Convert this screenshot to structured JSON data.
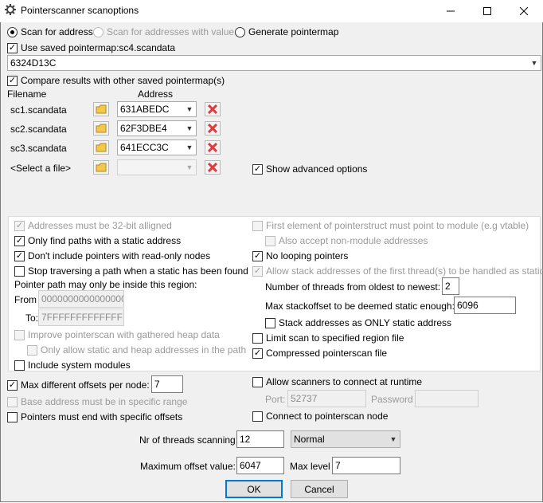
{
  "window": {
    "title": "Pointerscanner scanoptions",
    "minimize_icon": "minimize-icon",
    "maximize_icon": "maximize-icon",
    "close_icon": "close-icon"
  },
  "scan_mode": {
    "scan_for_address": "Scan for address",
    "scan_for_value": "Scan for addresses with value",
    "generate_pointermap": "Generate pointermap",
    "selected": "scan_for_address"
  },
  "saved_pointermap": {
    "label": "Use saved pointermap:sc4.scandata",
    "checked": true,
    "address_value": "6324D13C"
  },
  "compare": {
    "label": "Compare results with other saved pointermap(s)",
    "checked": true,
    "header_filename": "Filename",
    "header_address": "Address",
    "rows": [
      {
        "filename": "sc1.scandata",
        "address": "631ABEDC"
      },
      {
        "filename": "sc2.scandata",
        "address": "62F3DBE4"
      },
      {
        "filename": "sc3.scandata",
        "address": "641ECC3C"
      },
      {
        "filename": "<Select a file>",
        "address": ""
      }
    ]
  },
  "show_advanced": {
    "label": "Show advanced options",
    "checked": true
  },
  "advanced_left": {
    "aligned": {
      "label": "Addresses must be 32-bit alligned",
      "checked": true,
      "disabled": true
    },
    "static_only": {
      "label": "Only find paths with a static address",
      "checked": true
    },
    "no_readonly": {
      "label": "Don't include pointers with read-only nodes",
      "checked": true
    },
    "stop_traversing": {
      "label": "Stop traversing a path when a static has been found",
      "checked": false
    },
    "region_label": "Pointer path may only be inside this region:",
    "from_label": "From",
    "from_value": "0000000000000000",
    "to_label": "To:",
    "to_value": "7FFFFFFFFFFFFFFF",
    "improve_heap": {
      "label": "Improve pointerscan with gathered heap data",
      "checked": false,
      "disabled": true
    },
    "only_static_heap": {
      "label": "Only allow static and heap addresses in the path",
      "checked": false,
      "disabled": true
    },
    "system_modules": {
      "label": "Include system modules",
      "checked": false
    }
  },
  "advanced_right": {
    "first_element": {
      "label": "First element of pointerstruct must point to module (e.g vtable)",
      "checked": false,
      "disabled": true
    },
    "non_module": {
      "label": "Also accept non-module addresses",
      "checked": false,
      "disabled": true
    },
    "no_looping": {
      "label": "No looping pointers",
      "checked": true
    },
    "stack_first_thread": {
      "label": "Allow stack addresses of the first thread(s) to be handled as static",
      "checked": true,
      "disabled": true
    },
    "threads_label": "Number of threads from oldest to newest:",
    "threads_value": "2",
    "stackoffset_label": "Max stackoffset to be deemed static enough:",
    "stackoffset_value": "6096",
    "stack_only_static": {
      "label": "Stack addresses as ONLY static address",
      "checked": false
    },
    "limit_region": {
      "label": "Limit scan to specified region file",
      "checked": false
    },
    "compressed": {
      "label": "Compressed pointerscan file",
      "checked": true
    }
  },
  "bottom": {
    "max_offsets": {
      "label": "Max different offsets per node:",
      "checked": true,
      "value": "7"
    },
    "base_address": {
      "label": "Base address must be in specific range",
      "checked": false,
      "disabled": true
    },
    "specific_offsets": {
      "label": "Pointers must end with specific offsets",
      "checked": false
    },
    "allow_scanners": {
      "label": "Allow scanners to connect at runtime",
      "checked": false
    },
    "port_label": "Port:",
    "port_value": "52737",
    "password_label": "Password",
    "connect_node": {
      "label": "Connect to pointerscan node",
      "checked": false
    },
    "threads_label": "Nr of threads scanning:",
    "threads_value": "12",
    "priority_value": "Normal",
    "max_offset_label": "Maximum offset value:",
    "max_offset_value": "6047",
    "max_level_label": "Max level",
    "max_level_value": "7",
    "ok_label": "OK",
    "cancel_label": "Cancel"
  },
  "colors": {
    "accent": "#0078d7",
    "delete_red": "#e03a3a",
    "folder_yellow": "#f2c94c"
  }
}
